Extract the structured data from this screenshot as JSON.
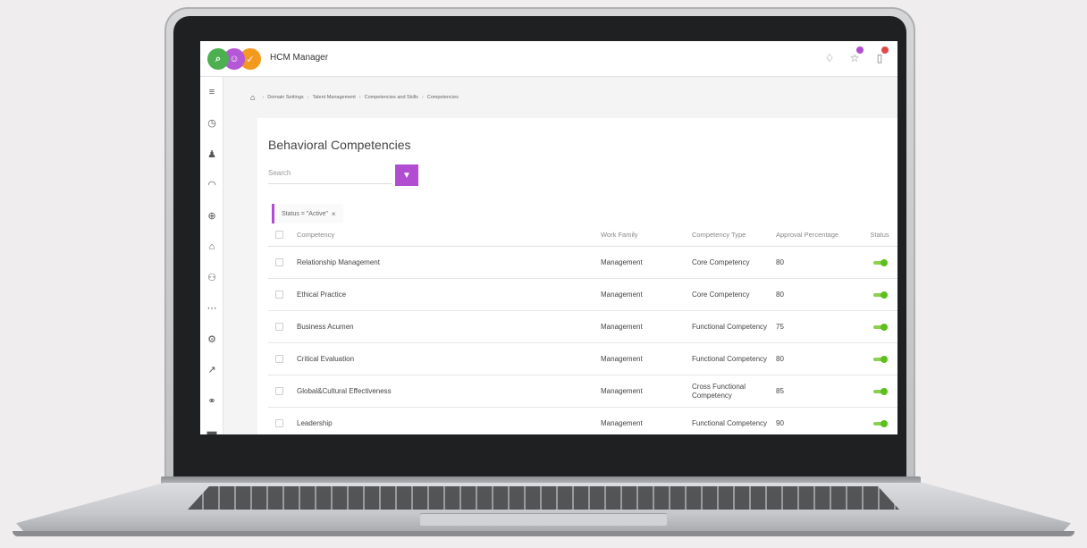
{
  "header": {
    "app_title": "HCM Manager",
    "brand_dots": [
      {
        "icon": "search-icon",
        "glyph": "⌕",
        "color": "#4caf50"
      },
      {
        "icon": "user-icon",
        "glyph": "☺",
        "color": "#b557d6"
      },
      {
        "icon": "check-icon",
        "glyph": "✓",
        "color": "#f39a1e"
      }
    ],
    "icons": [
      {
        "icon": "bell-icon",
        "glyph": "♢",
        "badge": ""
      },
      {
        "icon": "notification-icon",
        "glyph": "☆",
        "badge": "#b14dd1"
      },
      {
        "icon": "clipboard-icon",
        "glyph": "▯",
        "badge": "#e04848"
      }
    ]
  },
  "sidebar": {
    "items": [
      {
        "icon": "menu-icon",
        "glyph": "≡"
      },
      {
        "icon": "clock-icon",
        "glyph": "◷"
      },
      {
        "icon": "person-icon",
        "glyph": "♟"
      },
      {
        "icon": "gauge-icon",
        "glyph": "◠"
      },
      {
        "icon": "search-zoom-icon",
        "glyph": "⊕"
      },
      {
        "icon": "graduation-cap-icon",
        "glyph": "⌂"
      },
      {
        "icon": "users-icon",
        "glyph": "⚇"
      },
      {
        "icon": "team-icon",
        "glyph": "⋯"
      },
      {
        "icon": "gear-icon",
        "glyph": "⚙"
      },
      {
        "icon": "chart-icon",
        "glyph": "↗"
      },
      {
        "icon": "group-icon",
        "glyph": "⚭"
      },
      {
        "icon": "folder-icon",
        "glyph": "▬"
      }
    ]
  },
  "breadcrumb": {
    "items": [
      "Domain Settings",
      "Talent Management",
      "Competencies and Skills",
      "Competencies"
    ]
  },
  "page": {
    "title": "Behavioral Competencies",
    "search_placeholder": "Search",
    "filter_chip": "Status = \"Active\"",
    "chip_remove": "×"
  },
  "table": {
    "headers": {
      "competency": "Competency",
      "work_family": "Work Family",
      "competency_type": "Competency Type",
      "approval_percentage": "Approval Percentage",
      "status": "Status"
    },
    "rows": [
      {
        "competency": "Relationship Management",
        "work_family": "Management",
        "type": "Core Competency",
        "approval": "80"
      },
      {
        "competency": "Ethical Practice",
        "work_family": "Management",
        "type": "Core Competency",
        "approval": "80"
      },
      {
        "competency": "Business Acumen",
        "work_family": "Management",
        "type": "Functional Competency",
        "approval": "75"
      },
      {
        "competency": "Critical Evaluation",
        "work_family": "Management",
        "type": "Functional Competency",
        "approval": "80"
      },
      {
        "competency": "Global&Cultural Effectiveness",
        "work_family": "Management",
        "type": "Cross Functional Competency",
        "approval": "85"
      },
      {
        "competency": "Leadership",
        "work_family": "Management",
        "type": "Functional Competency",
        "approval": "90"
      }
    ]
  },
  "colors": {
    "accent": "#b14dd1",
    "status_active": "#5cbf1e"
  }
}
